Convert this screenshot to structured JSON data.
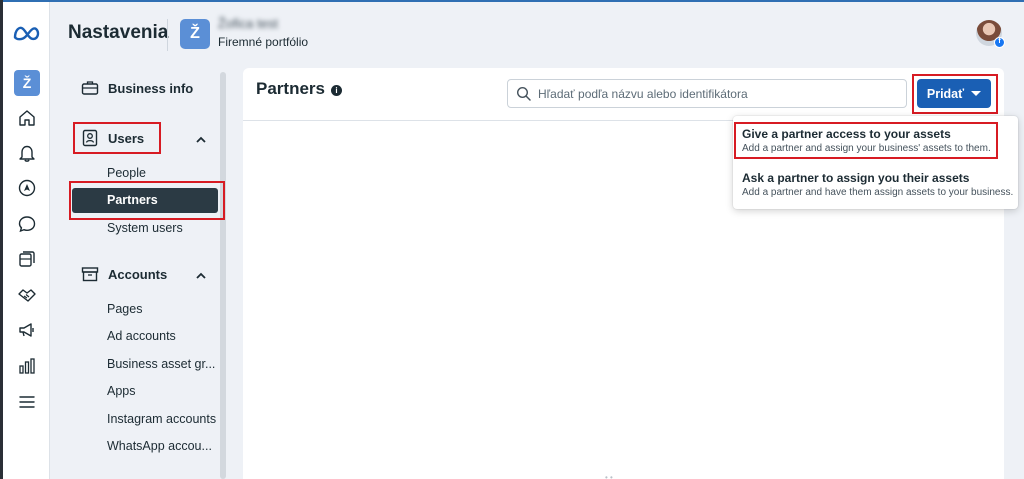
{
  "app": {
    "title": "Nastavenia",
    "workspace_initial": "Ž",
    "portfolio": {
      "initial": "Ž",
      "name": "Žofica test",
      "subtitle": "Firemné portfólio"
    }
  },
  "rail": {
    "icons": [
      "meta-logo",
      "home-icon",
      "bell-icon",
      "compass-icon",
      "chat-icon",
      "pages-icon",
      "handshake-icon",
      "megaphone-icon",
      "bar-chart-icon",
      "menu-icon"
    ]
  },
  "nav": {
    "business_info": "Business info",
    "users": {
      "label": "Users",
      "items": [
        "People",
        "Partners",
        "System users"
      ]
    },
    "accounts": {
      "label": "Accounts",
      "items": [
        "Pages",
        "Ad accounts",
        "Business asset gr...",
        "Apps",
        "Instagram accounts",
        "WhatsApp accou..."
      ]
    }
  },
  "main": {
    "title": "Partners",
    "search_placeholder": "Hľadať podľa názvu alebo identifikátora",
    "add_button": "Pridať"
  },
  "dropdown": {
    "items": [
      {
        "title": "Give a partner access to your assets",
        "desc": "Add a partner and assign your business' assets to them."
      },
      {
        "title": "Ask a partner to assign you their assets",
        "desc": "Add a partner and have them assign assets to your business."
      }
    ]
  },
  "colors": {
    "accent": "#1a5fb4",
    "active_nav": "#2b3a44",
    "highlight_red": "#d71b23",
    "workspace_badge": "#5b8fd6"
  }
}
